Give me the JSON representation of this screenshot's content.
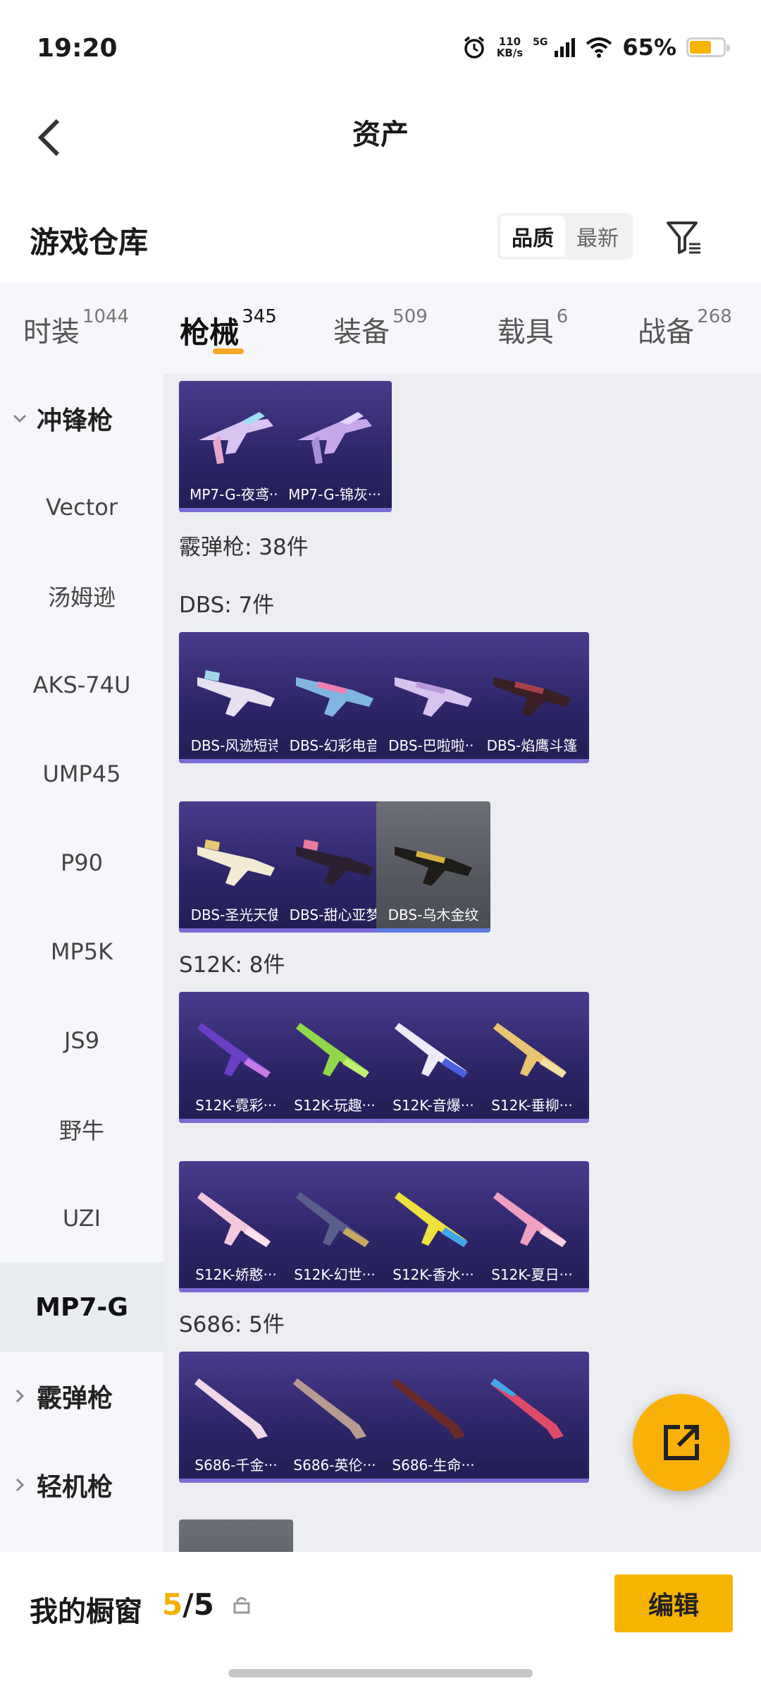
{
  "status": {
    "time": "19:20",
    "speed_value": "110",
    "speed_unit": "KB/s",
    "network": "5G",
    "battery_pct": "65%",
    "battery_level": 0.65
  },
  "header": {
    "title": "资产"
  },
  "warehouse": {
    "title": "游戏仓库",
    "sort_quality": "品质",
    "sort_newest": "最新"
  },
  "tabs": [
    {
      "label": "时装",
      "count": "1044"
    },
    {
      "label": "枪械",
      "count": "345"
    },
    {
      "label": "装备",
      "count": "509"
    },
    {
      "label": "载具",
      "count": "6"
    },
    {
      "label": "战备",
      "count": "268"
    }
  ],
  "sidebar": {
    "items": [
      "冲锋枪",
      "Vector",
      "汤姆逊",
      "AKS-74U",
      "UMP45",
      "P90",
      "MP5K",
      "JS9",
      "野牛",
      "UZI",
      "MP7-G",
      "霰弹枪",
      "轻机枪"
    ]
  },
  "sections": {
    "shotgun_total": "霰弹枪: 38件",
    "dbs": "DBS: 7件",
    "s12k": "S12K: 8件",
    "s686": "S686: 5件"
  },
  "cards": {
    "mp7": [
      "MP7-G-夜鸢···",
      "MP7-G-锦灰···"
    ],
    "dbs": [
      "DBS-风迹短诗",
      "DBS-幻彩电音",
      "DBS-巴啦啦···",
      "DBS-焰鹰斗篷",
      "DBS-圣光天使",
      "DBS-甜心亚梦",
      "DBS-乌木金纹"
    ],
    "s12k": [
      "S12K-霓彩···",
      "S12K-玩趣···",
      "S12K-音爆···",
      "S12K-垂柳···",
      "S12K-娇憨···",
      "S12K-幻世···",
      "S12K-香水···",
      "S12K-夏日···"
    ],
    "s686": [
      "S686-千金···",
      "S686-英伦···",
      "S686-生命···"
    ]
  },
  "bottom": {
    "window_label": "我的橱窗",
    "window_used": "5",
    "window_total": "/5",
    "edit_label": "编辑"
  },
  "colors": {
    "accent": "#f6b400",
    "card_purple": "#2e2669",
    "card_grey": "#55575f"
  }
}
